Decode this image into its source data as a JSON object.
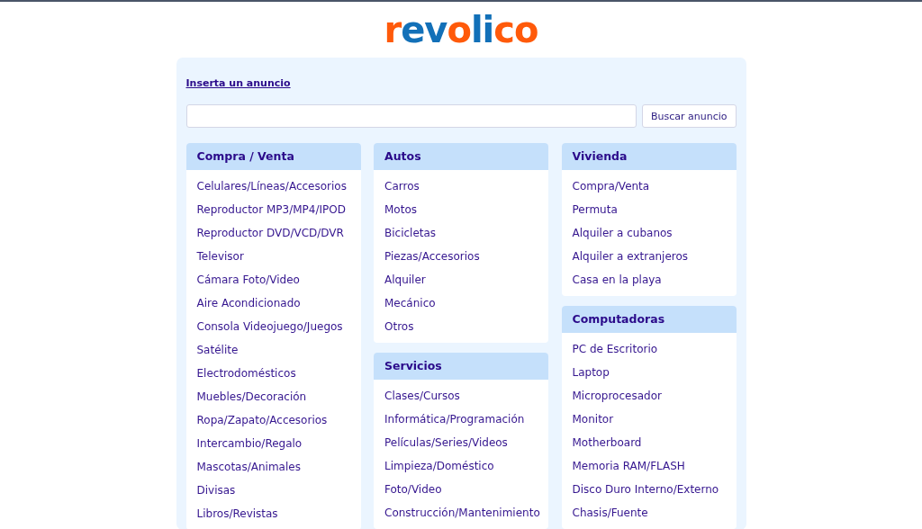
{
  "logo": {
    "parts": [
      {
        "text": "r",
        "color": "#ff5a0a"
      },
      {
        "text": "ev",
        "color": "#1270b8"
      },
      {
        "text": "o",
        "color": "#ff5a0a"
      },
      {
        "text": "li",
        "color": "#1270b8"
      },
      {
        "text": "co",
        "color": "#ff5a0a"
      }
    ]
  },
  "insert_link": "Inserta un anuncio",
  "search": {
    "button": "Buscar anuncio"
  },
  "columns": [
    {
      "sections": [
        {
          "title": "Compra / Venta",
          "items": [
            "Celulares/Líneas/Accesorios",
            "Reproductor MP3/MP4/IPOD",
            "Reproductor DVD/VCD/DVR",
            "Televisor",
            "Cámara Foto/Video",
            "Aire Acondicionado",
            "Consola Videojuego/Juegos",
            "Satélite",
            "Electrodomésticos",
            "Muebles/Decoración",
            "Ropa/Zapato/Accesorios",
            "Intercambio/Regalo",
            "Mascotas/Animales",
            "Divisas",
            "Libros/Revistas"
          ]
        }
      ]
    },
    {
      "sections": [
        {
          "title": "Autos",
          "items": [
            "Carros",
            "Motos",
            "Bicicletas",
            "Piezas/Accesorios",
            "Alquiler",
            "Mecánico",
            "Otros"
          ]
        },
        {
          "title": "Servicios",
          "items": [
            "Clases/Cursos",
            "Informática/Programación",
            "Películas/Series/Videos",
            "Limpieza/Doméstico",
            "Foto/Video",
            "Construcción/Mantenimiento"
          ]
        }
      ]
    },
    {
      "sections": [
        {
          "title": "Vivienda",
          "items": [
            "Compra/Venta",
            "Permuta",
            "Alquiler a cubanos",
            "Alquiler a extranjeros",
            "Casa en la playa"
          ]
        },
        {
          "title": "Computadoras",
          "items": [
            "PC de Escritorio",
            "Laptop",
            "Microprocesador",
            "Monitor",
            "Motherboard",
            "Memoria RAM/FLASH",
            "Disco Duro Interno/Externo",
            "Chasis/Fuente"
          ]
        }
      ]
    }
  ]
}
